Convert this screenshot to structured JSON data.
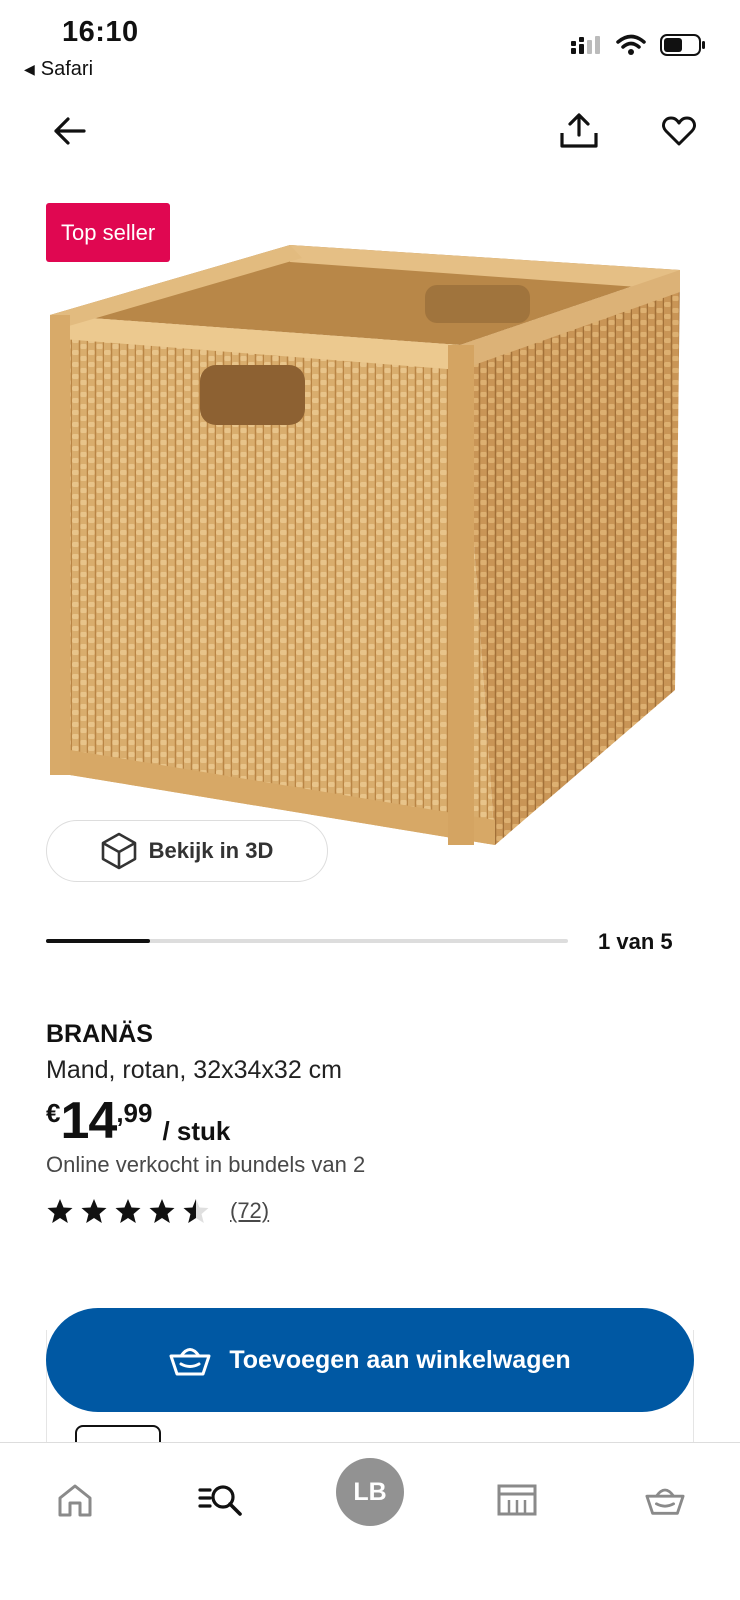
{
  "status_bar": {
    "time": "16:10",
    "back_app_label": "Safari",
    "icons": [
      "cellular-signal-icon",
      "wifi-icon",
      "battery-icon"
    ]
  },
  "top_nav": {
    "icons": [
      "arrow-left-icon",
      "share-icon",
      "heart-icon"
    ]
  },
  "product_media": {
    "badge": "Top seller",
    "badge_color": "#e00751",
    "view_3d_label": "Bekijk in 3D",
    "carousel_progress": 0.2,
    "carousel_counter": "1 van 5"
  },
  "product": {
    "name": "BRANÄS",
    "description": "Mand, rotan, 32x34x32 cm",
    "price": {
      "currency": "€",
      "integer": "14",
      "decimals": ",99",
      "unit": "/ stuk"
    },
    "bundle_note": "Online verkocht in bundels van 2",
    "rating": {
      "stars": 4.5,
      "max_stars": 5,
      "review_count": "(72)"
    }
  },
  "cart": {
    "add_button_label": "Toevoegen aan winkelwagen",
    "button_color": "#0058a3"
  },
  "tab_bar": {
    "items": [
      "home-icon",
      "search-list-icon",
      "profile-avatar",
      "store-icon",
      "cart-icon"
    ],
    "avatar_initials": "LB"
  }
}
